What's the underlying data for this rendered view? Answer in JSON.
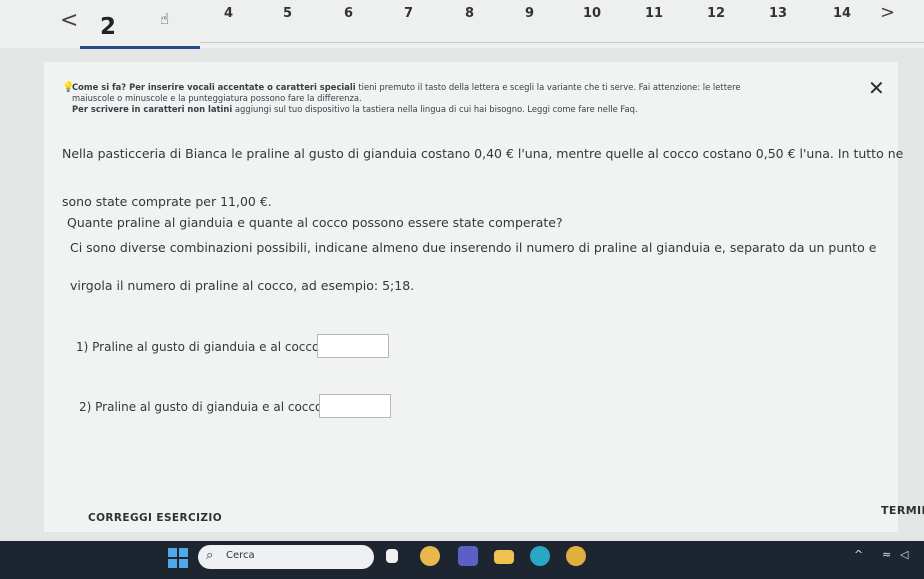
{
  "pager": {
    "prev": "<",
    "current": "2",
    "numbers": [
      "4",
      "5",
      "6",
      "7",
      "8",
      "9",
      "10",
      "11",
      "12",
      "13",
      "14"
    ],
    "next": ">"
  },
  "tip": {
    "bold1": "Come si fa? Per inserire vocali accentate o caratteri speciali",
    "text1": " tieni premuto il tasto della lettera e scegli la variante che ti serve. Fai attenzione: le lettere",
    "text2": "maiuscole o minuscole e la punteggiatura possono fare la differenza.",
    "bold2": "Per scrivere in caratteri non latini",
    "text3": " aggiungi sul tuo dispositivo la tastiera nella lingua di cui hai bisogno. Leggi come fare nelle Faq.",
    "close": "✕"
  },
  "problem": {
    "line1": "Nella pasticceria di Bianca le praline al gusto di gianduia costano 0,40 € l'una, mentre quelle al cocco costano 0,50 € l'una. In tutto ne",
    "line2": "sono state comprate per 11,00 €.",
    "line3": "Quante praline al gianduia e quante al cocco possono essere state comperate?",
    "line4": "Ci sono diverse combinazioni possibili, indicane almeno due inserendo il numero di praline al gianduia e, separato da un punto e",
    "line5": "virgola il numero di praline al cocco, ad esempio: 5;18."
  },
  "answers": [
    {
      "label": "1) Praline al gusto di gianduia e al cocco",
      "value": ""
    },
    {
      "label": "2) Praline al gusto di gianduia e al cocco",
      "value": ""
    }
  ],
  "buttons": {
    "check": "CORREGGI ESERCIZIO",
    "finish": "TERMIN"
  },
  "taskbar": {
    "search_placeholder": "Cerca",
    "icons": [
      "windows-start-icon",
      "file-explorer-icon",
      "chrome-icon",
      "teams-icon",
      "folder-icon",
      "edge-icon",
      "chrome-canary-icon"
    ],
    "tray": [
      "chevron-up-icon",
      "wifi-icon",
      "speaker-icon"
    ]
  }
}
